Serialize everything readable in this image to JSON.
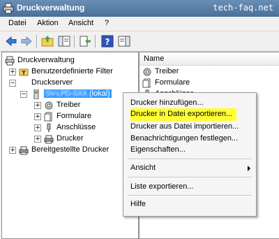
{
  "titlebar": {
    "title": "Druckverwaltung",
    "site": "tech-faq.net"
  },
  "menu": {
    "items": [
      "Datei",
      "Aktion",
      "Ansicht",
      "?"
    ]
  },
  "tree": {
    "root": "Druckverwaltung",
    "custom_filters": "Benutzerdefinierte Filter",
    "print_servers": "Druckserver",
    "server_name": "SV-LPD-SXX",
    "server_suffix": "(lokal)",
    "drivers": "Treiber",
    "forms": "Formulare",
    "ports": "Anschlüsse",
    "printers": "Drucker",
    "deployed_printers": "Bereitgestellte Drucker"
  },
  "right": {
    "column_name": "Name",
    "rows": [
      "Treiber",
      "Formulare",
      "Anschlüsse"
    ]
  },
  "context_menu": {
    "add_printer": "Drucker hinzufügen...",
    "export_printers": "Drucker in Datei exportieren...",
    "import_printers": "Drucker aus Datei importieren...",
    "notifications": "Benachrichtigungen festlegen...",
    "properties": "Eigenschaften...",
    "view": "Ansicht",
    "export_list": "Liste exportieren...",
    "help": "Hilfe"
  },
  "colors": {
    "highlight": "#ffff33",
    "selection": "#3399ff",
    "titlebar": "#5a7fa8"
  }
}
